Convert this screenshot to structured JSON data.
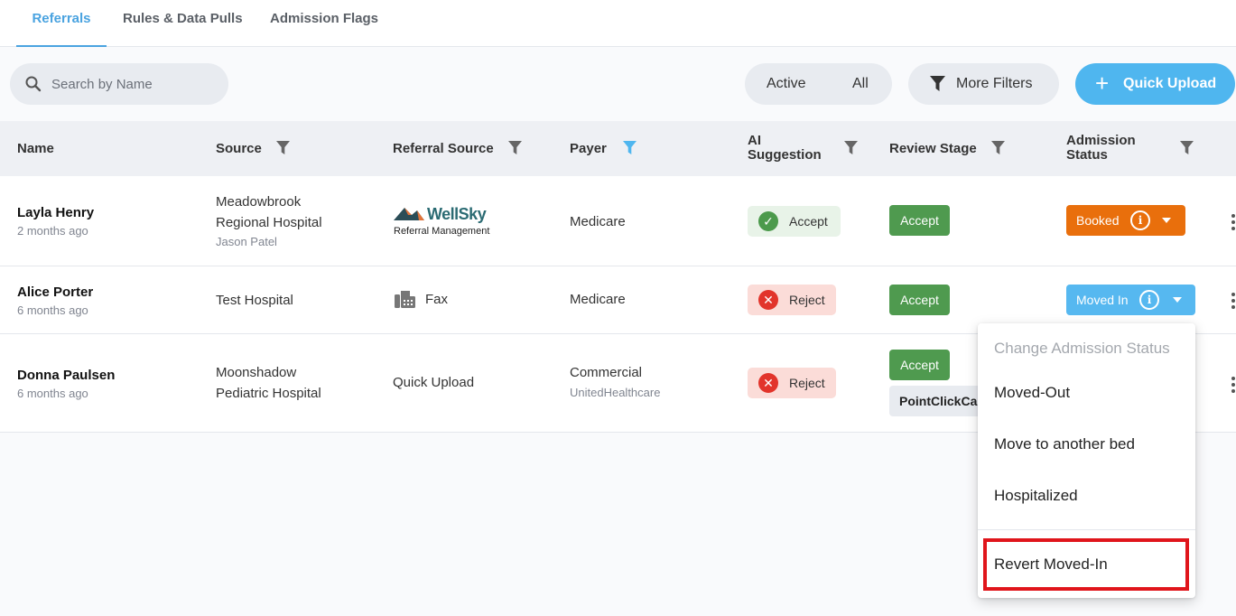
{
  "tabs": [
    {
      "label": "Referrals",
      "active": true
    },
    {
      "label": "Rules & Data Pulls",
      "active": false
    },
    {
      "label": "Admission Flags",
      "active": false
    }
  ],
  "toolbar": {
    "search_placeholder": "Search by Name",
    "toggle_active": "Active",
    "toggle_all": "All",
    "more_filters": "More Filters",
    "quick_upload": "Quick Upload"
  },
  "columns": {
    "name": "Name",
    "source": "Source",
    "referral_source": "Referral Source",
    "payer": "Payer",
    "ai_suggestion_line1": "AI",
    "ai_suggestion_line2": "Suggestion",
    "review_stage": "Review Stage",
    "admission_status_line1": "Admission",
    "admission_status_line2": "Status"
  },
  "rows": [
    {
      "name": "Layla Henry",
      "time": "2 months ago",
      "source_line1": "Meadowbrook",
      "source_line2": "Regional Hospital",
      "source_contact": "Jason Patel",
      "referral_logo_text": "WellSky",
      "referral_logo_sub": "Referral Management",
      "payer": "Medicare",
      "ai": "Accept",
      "stage": "Accept",
      "status": "Booked"
    },
    {
      "name": "Alice Porter",
      "time": "6 months ago",
      "source_line1": "Test Hospital",
      "referral_source": "Fax",
      "payer": "Medicare",
      "ai": "Reject",
      "stage": "Accept",
      "status": "Moved In"
    },
    {
      "name": "Donna Paulsen",
      "time": "6 months ago",
      "source_line1": "Moonshadow",
      "source_line2": "Pediatric Hospital",
      "referral_source": "Quick Upload",
      "payer": "Commercial",
      "payer_sub": "UnitedHealthcare",
      "ai": "Reject",
      "stage": "Accept",
      "stage_chip": "PointClickCare"
    }
  ],
  "menu": {
    "title": "Change Admission Status",
    "items": [
      "Moved-Out",
      "Move to another bed",
      "Hospitalized",
      "Revert Moved-In"
    ]
  },
  "colors": {
    "accent": "#4aa3e0",
    "booked": "#e96f0c",
    "moved_in": "#56b8f0",
    "stage_accept": "#4f9a4f",
    "highlight": "#e0151b"
  }
}
